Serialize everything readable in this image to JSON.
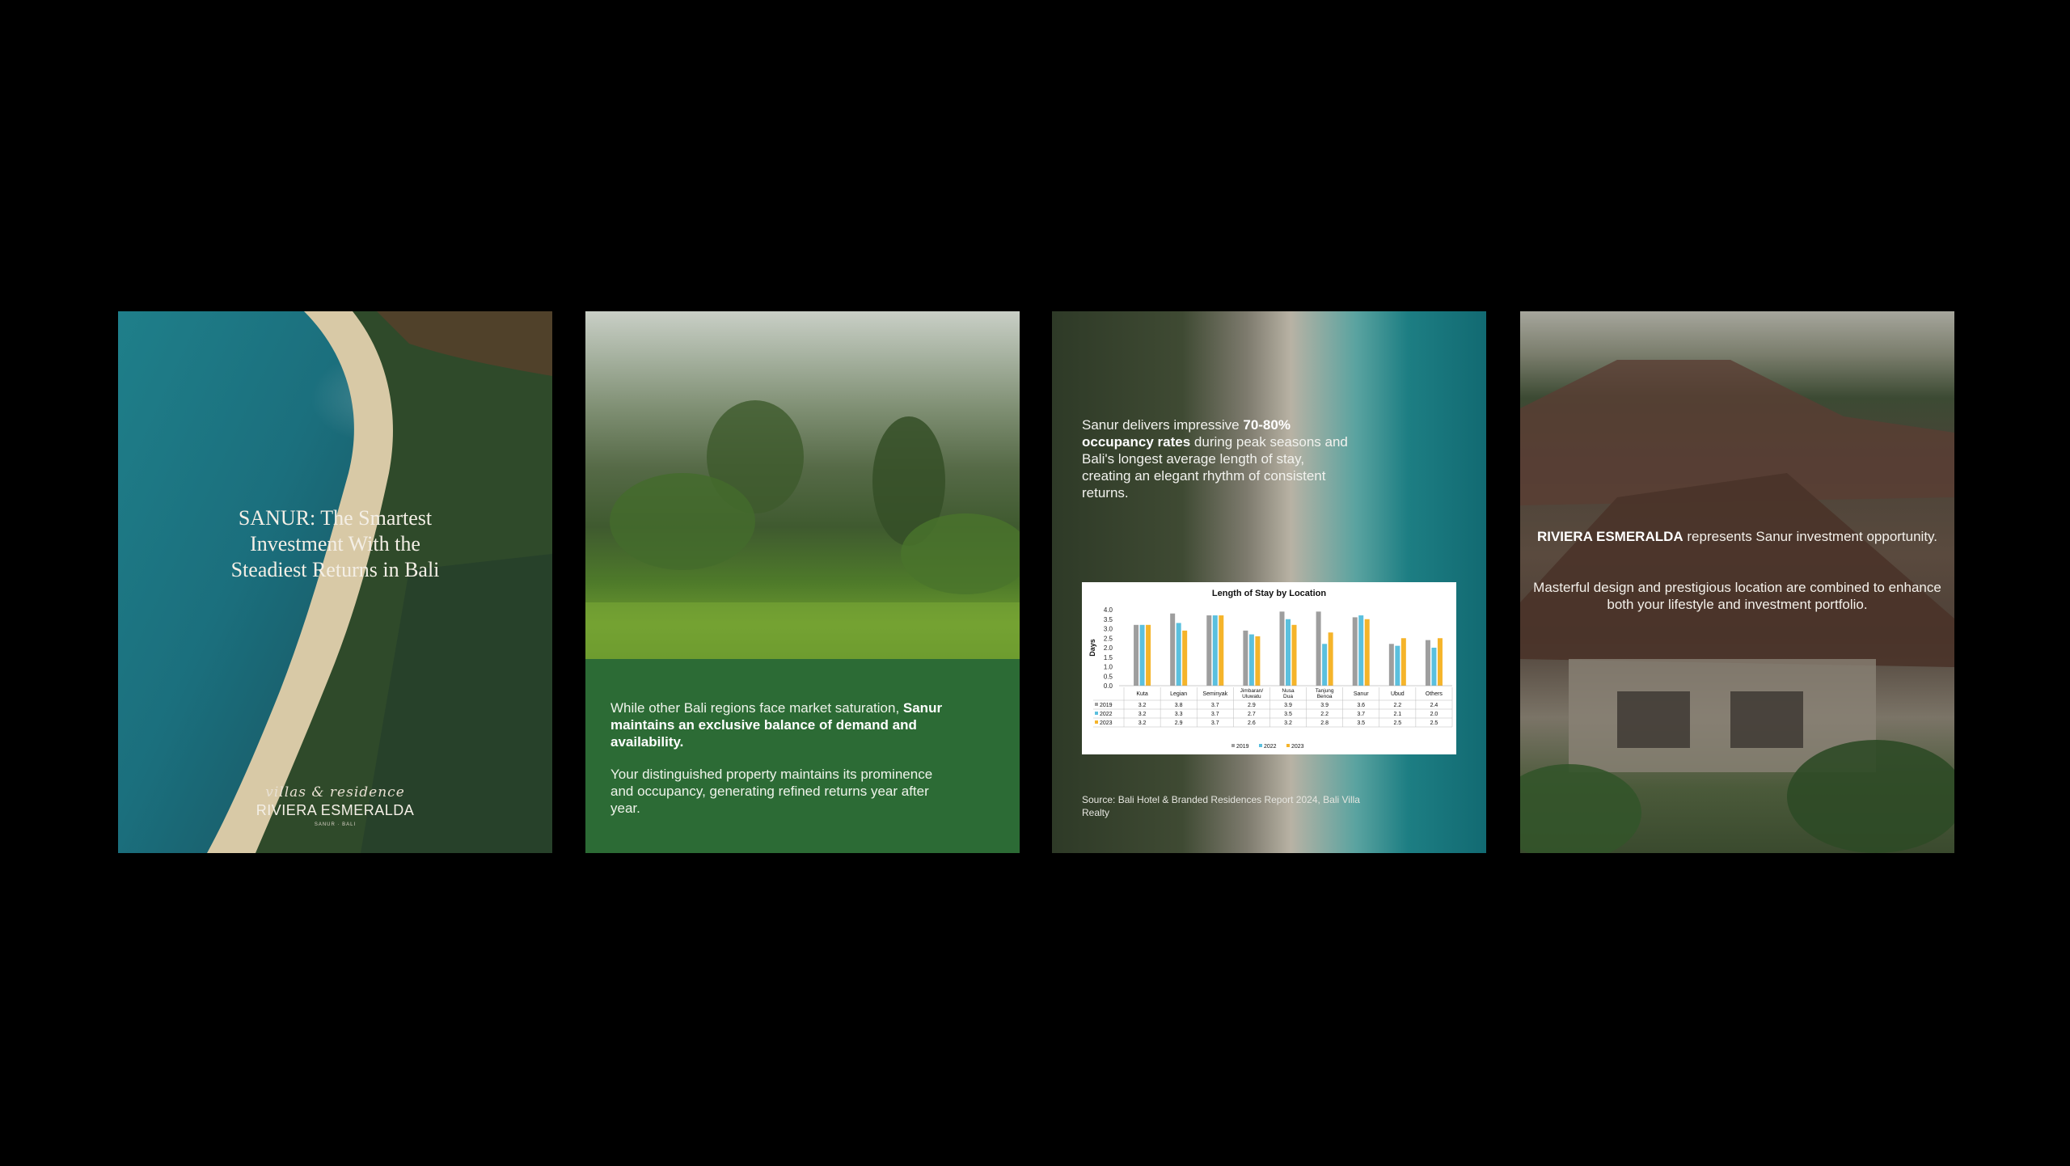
{
  "panel1": {
    "title_lines": [
      "SANUR: The Smartest",
      "Investment With the",
      "Steadiest Returns in Bali"
    ],
    "script_text": "villas & residence",
    "brand": "RIVIERA ESMERALDA",
    "location": "SANUR · BALI"
  },
  "panel2": {
    "para1_plain": "While other Bali regions face market saturation, ",
    "para1_bold": "Sanur maintains an exclusive balance of demand and availability.",
    "para2": "Your distinguished property maintains its prominence and occupancy, generating refined returns year after year."
  },
  "panel3": {
    "text_a": "Sanur delivers impressive ",
    "text_bold": "70-80% occupancy rates",
    "text_b": " during peak seasons and Bali's longest average length of stay, creating an elegant rhythm of consistent returns.",
    "source": "Source: Bali Hotel & Branded Residences Report 2024, Bali Villa Realty"
  },
  "panel4": {
    "line1_bold": "RIVIERA ESMERALDA",
    "line1_rest": " represents Sanur investment opportunity.",
    "para2": "Masterful design and prestigious location are combined to enhance both your lifestyle and investment portfolio."
  },
  "chart_data": {
    "type": "bar",
    "title": "Length of Stay by Location",
    "ylabel": "Days",
    "ylim": [
      0,
      4.0
    ],
    "yticks": [
      "4.0",
      "3.5",
      "3.0",
      "2.5",
      "2.0",
      "1.5",
      "1.0",
      "0.5",
      "0.0"
    ],
    "categories": [
      "Kuta",
      "Legian",
      "Seminyak",
      "Jimbaran/ Uluwatu",
      "Nusa Dua",
      "Tanjung Benoa",
      "Sanur",
      "Ubud",
      "Others"
    ],
    "series": [
      {
        "name": "2019",
        "color": "#9e9e9e",
        "values": [
          3.2,
          3.8,
          3.7,
          2.9,
          3.9,
          3.9,
          3.6,
          2.2,
          2.4
        ],
        "labels": [
          "3.2",
          "3.8",
          "3.7",
          "2.9",
          "3.9",
          "3.9",
          "3.6",
          "2.2",
          "2.4"
        ]
      },
      {
        "name": "2022",
        "color": "#5bc0de",
        "values": [
          3.2,
          3.3,
          3.7,
          2.7,
          3.5,
          2.2,
          3.7,
          2.1,
          2.0
        ],
        "labels": [
          "3.2",
          "3.3",
          "3.7",
          "2.7",
          "3.5",
          "2.2",
          "3.7",
          "2.1",
          "2.0"
        ]
      },
      {
        "name": "2023",
        "color": "#f5b42a",
        "values": [
          3.2,
          2.9,
          3.7,
          2.6,
          3.2,
          2.8,
          3.5,
          2.5,
          2.5
        ],
        "labels": [
          "3.2",
          "2.9",
          "3.7",
          "2.6",
          "3.2",
          "2.8",
          "3.5",
          "2.5",
          "2.5"
        ]
      }
    ],
    "legend": "bottom",
    "grid": false
  }
}
